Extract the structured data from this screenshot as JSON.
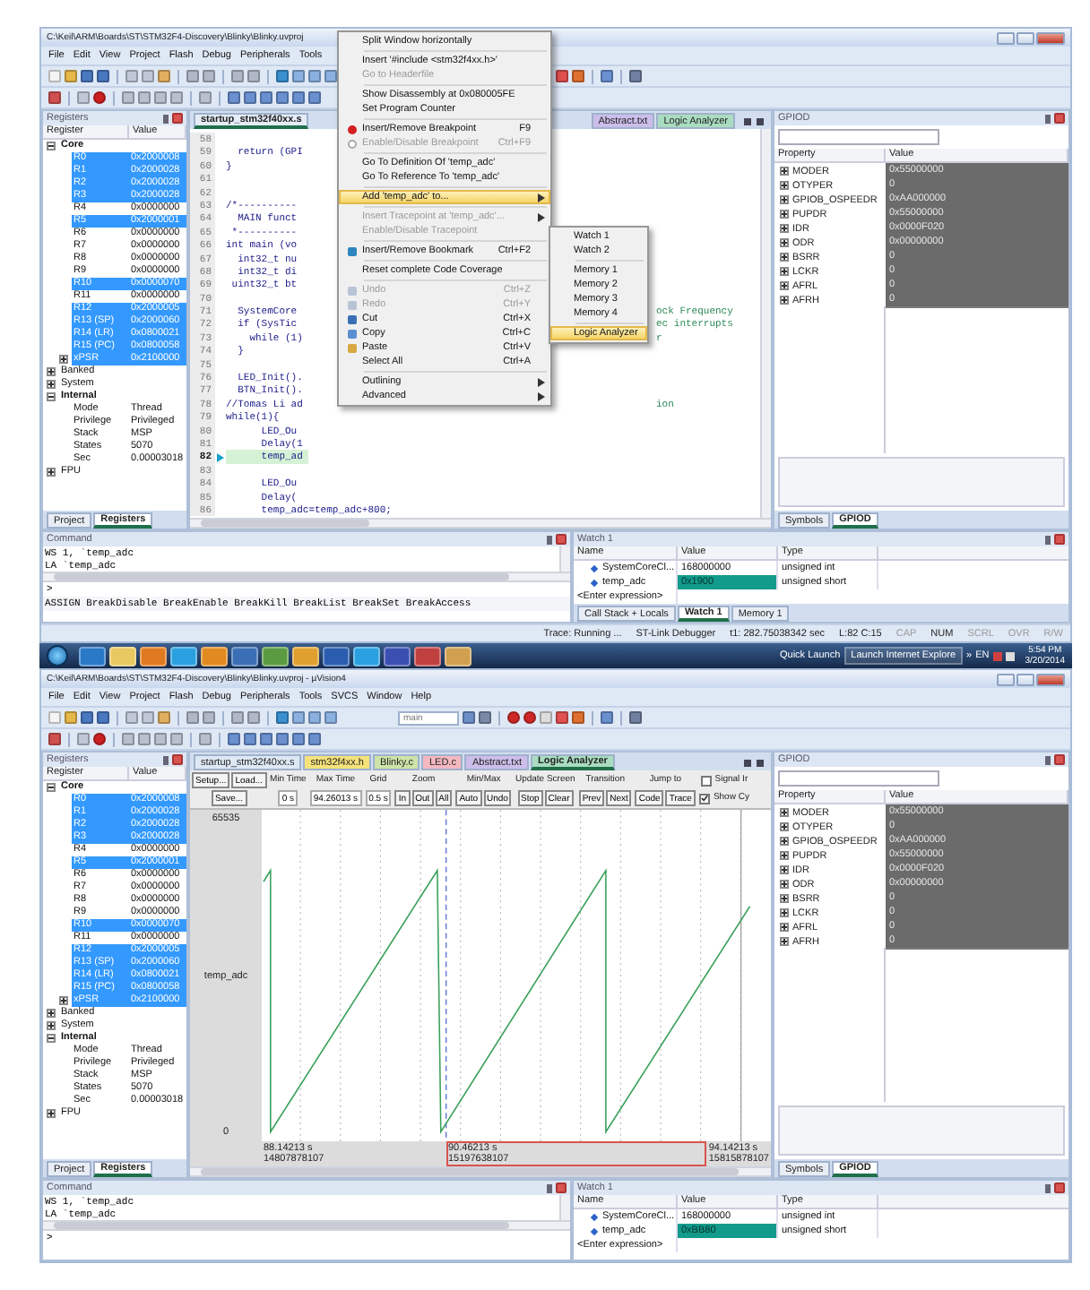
{
  "windows": [
    {
      "kind": "editor",
      "title": "C:\\Keil\\ARM\\Boards\\ST\\STM32F4-Discovery\\Blinky\\Blinky.uvproj",
      "menu": [
        "File",
        "Edit",
        "View",
        "Project",
        "Flash",
        "Debug",
        "Peripherals",
        "Tools"
      ],
      "registers": {
        "title": "Registers",
        "columns": [
          "Register",
          "Value"
        ],
        "tree": [
          {
            "name": "Core",
            "expanded": true,
            "children": [
              {
                "name": "R0",
                "value": "0x2000008",
                "selected": true
              },
              {
                "name": "R1",
                "value": "0x2000028",
                "selected": true
              },
              {
                "name": "R2",
                "value": "0x2000028",
                "selected": true
              },
              {
                "name": "R3",
                "value": "0x2000028",
                "selected": true
              },
              {
                "name": "R4",
                "value": "0x0000000",
                "selected": false
              },
              {
                "name": "R5",
                "value": "0x2000001",
                "selected": true
              },
              {
                "name": "R6",
                "value": "0x0000000",
                "selected": false
              },
              {
                "name": "R7",
                "value": "0x0000000",
                "selected": false
              },
              {
                "name": "R8",
                "value": "0x0000000",
                "selected": false
              },
              {
                "name": "R9",
                "value": "0x0000000",
                "selected": false
              },
              {
                "name": "R10",
                "value": "0x0000070",
                "selected": true
              },
              {
                "name": "R11",
                "value": "0x0000000",
                "selected": false
              },
              {
                "name": "R12",
                "value": "0x2000005",
                "selected": true
              },
              {
                "name": "R13 (SP)",
                "value": "0x2000060",
                "selected": true
              },
              {
                "name": "R14 (LR)",
                "value": "0x0800021",
                "selected": true
              },
              {
                "name": "R15 (PC)",
                "value": "0x0800058",
                "selected": true
              },
              {
                "name": "xPSR",
                "value": "0x2100000",
                "selected": true,
                "expanded": false
              }
            ]
          },
          {
            "name": "Banked",
            "expanded": false
          },
          {
            "name": "System",
            "expanded": false
          },
          {
            "name": "Internal",
            "expanded": true,
            "children": [
              {
                "name": "Mode",
                "value": "Thread",
                "selected": false
              },
              {
                "name": "Privilege",
                "value": "Privileged",
                "selected": false
              },
              {
                "name": "Stack",
                "value": "MSP",
                "selected": false
              },
              {
                "name": "States",
                "value": "5070",
                "selected": false
              },
              {
                "name": "Sec",
                "value": "0.00003018",
                "selected": false
              }
            ]
          },
          {
            "name": "FPU",
            "expanded": false
          }
        ],
        "tabs": [
          {
            "label": "Project",
            "selected": false
          },
          {
            "label": "Registers",
            "selected": true
          }
        ]
      },
      "editor": {
        "tabs": [
          {
            "label": "startup_stm32f40xx.s",
            "color": "#e4ecf7",
            "selected": true
          },
          {
            "label": "Abstract.txt",
            "color": "#cdbdea",
            "selected": false
          },
          {
            "label": "Logic Analyzer",
            "color": "#a9dcc0",
            "selected": false
          }
        ],
        "lines": [
          {
            "number": "58",
            "current": false
          },
          {
            "number": "59",
            "text": "  return (GPI",
            "current": false
          },
          {
            "number": "60",
            "text": "}",
            "current": false
          },
          {
            "number": "61",
            "current": false
          },
          {
            "number": "62",
            "current": false
          },
          {
            "number": "63",
            "text": "/*----------",
            "current": false
          },
          {
            "number": "64",
            "text": "  MAIN funct",
            "current": false
          },
          {
            "number": "65",
            "text": " *----------",
            "current": false
          },
          {
            "number": "66",
            "text": "int main (vo",
            "current": false
          },
          {
            "number": "67",
            "text": "  int32_t nu",
            "current": false
          },
          {
            "number": "68",
            "text": "  int32_t di",
            "current": false
          },
          {
            "number": "69",
            "text": " uint32_t bt",
            "current": false
          },
          {
            "number": "70",
            "current": false
          },
          {
            "number": "71",
            "text": "  SystemCore",
            "tail": "ock Frequency",
            "current": false
          },
          {
            "number": "72",
            "text": "  if (SysTic",
            "tail": "ec interrupts",
            "current": false
          },
          {
            "number": "73",
            "text": "    while (1)",
            "tail": "r",
            "current": false
          },
          {
            "number": "74",
            "text": "  }",
            "current": false
          },
          {
            "number": "75",
            "current": false
          },
          {
            "number": "76",
            "text": "  LED_Init().",
            "current": false
          },
          {
            "number": "77",
            "text": "  BTN_Init().",
            "current": false
          },
          {
            "number": "78",
            "text": "//Tomas Li ad",
            "tail": "ion",
            "current": false
          },
          {
            "number": "79",
            "text": "while(1){",
            "current": false
          },
          {
            "number": "80",
            "text": "      LED_Ou",
            "current": false
          },
          {
            "number": "81",
            "text": "      Delay(1",
            "current": false
          },
          {
            "number": "82",
            "text": "      temp_ad",
            "current": true
          },
          {
            "number": "83",
            "current": false
          },
          {
            "number": "84",
            "text": "      LED_Ou",
            "current": false
          },
          {
            "number": "85",
            "text": "      Delay(",
            "current": false
          },
          {
            "number": "86",
            "text": "      temp_adc=temp_adc+800;",
            "current": false
          }
        ],
        "context_menu": [
          {
            "kind": "item",
            "label": "Split Window horizontally",
            "disabled": false,
            "selected": false
          },
          {
            "kind": "separator"
          },
          {
            "kind": "item",
            "label": "Insert '#include <stm32f4xx.h>'",
            "disabled": false,
            "selected": false
          },
          {
            "kind": "item",
            "label": "Go to Headerfile",
            "disabled": true,
            "selected": false
          },
          {
            "kind": "separator"
          },
          {
            "kind": "item",
            "label": "Show Disassembly at 0x080005FE",
            "disabled": false,
            "selected": false
          },
          {
            "kind": "item",
            "label": "Set Program Counter",
            "disabled": false,
            "selected": false
          },
          {
            "kind": "separator"
          },
          {
            "kind": "item",
            "label": "Insert/Remove Breakpoint",
            "shortcut": "F9",
            "disabled": false,
            "selected": false
          },
          {
            "kind": "item",
            "label": "Enable/Disable Breakpoint",
            "shortcut": "Ctrl+F9",
            "disabled": true,
            "selected": false
          },
          {
            "kind": "separator"
          },
          {
            "kind": "item",
            "label": "Go To Definition Of 'temp_adc'",
            "disabled": false,
            "selected": false
          },
          {
            "kind": "item",
            "label": "Go To Reference To 'temp_adc'",
            "disabled": false,
            "selected": false
          },
          {
            "kind": "separator"
          },
          {
            "kind": "submenu",
            "label": "Add 'temp_adc' to...",
            "disabled": false,
            "selected": true
          },
          {
            "kind": "separator"
          },
          {
            "kind": "submenu",
            "label": "Insert Tracepoint at 'temp_adc'...",
            "disabled": true,
            "selected": false
          },
          {
            "kind": "item",
            "label": "Enable/Disable Tracepoint",
            "disabled": true,
            "selected": false
          },
          {
            "kind": "separator"
          },
          {
            "kind": "item",
            "label": "Insert/Remove Bookmark",
            "shortcut": "Ctrl+F2",
            "disabled": false,
            "selected": false
          },
          {
            "kind": "separator"
          },
          {
            "kind": "item",
            "label": "Reset complete Code Coverage",
            "disabled": false,
            "selected": false
          },
          {
            "kind": "separator"
          },
          {
            "kind": "item",
            "label": "Undo",
            "shortcut": "Ctrl+Z",
            "disabled": true,
            "selected": false
          },
          {
            "kind": "item",
            "label": "Redo",
            "shortcut": "Ctrl+Y",
            "disabled": true,
            "selected": false
          },
          {
            "kind": "item",
            "label": "Cut",
            "shortcut": "Ctrl+X",
            "disabled": false,
            "selected": false
          },
          {
            "kind": "item",
            "label": "Copy",
            "shortcut": "Ctrl+C",
            "disabled": false,
            "selected": false
          },
          {
            "kind": "item",
            "label": "Paste",
            "shortcut": "Ctrl+V",
            "disabled": false,
            "selected": false
          },
          {
            "kind": "item",
            "label": "Select All",
            "shortcut": "Ctrl+A",
            "disabled": false,
            "selected": false
          },
          {
            "kind": "separator"
          },
          {
            "kind": "submenu",
            "label": "Outlining",
            "disabled": false,
            "selected": false
          },
          {
            "kind": "submenu",
            "label": "Advanced",
            "disabled": false,
            "selected": false
          }
        ],
        "submenu": [
          {
            "kind": "item",
            "label": "Watch 1",
            "disabled": false,
            "selected": false
          },
          {
            "kind": "item",
            "label": "Watch 2",
            "disabled": false,
            "selected": false
          },
          {
            "kind": "separator"
          },
          {
            "kind": "item",
            "label": "Memory 1",
            "disabled": false,
            "selected": false
          },
          {
            "kind": "item",
            "label": "Memory 2",
            "disabled": false,
            "selected": false
          },
          {
            "kind": "item",
            "label": "Memory 3",
            "disabled": false,
            "selected": false
          },
          {
            "kind": "item",
            "label": "Memory 4",
            "disabled": false,
            "selected": false
          },
          {
            "kind": "separator"
          },
          {
            "kind": "item",
            "label": "Logic Analyzer",
            "disabled": false,
            "selected": true
          }
        ]
      },
      "gpio": {
        "title": "GPIOD",
        "columns": [
          "Property",
          "Value"
        ],
        "rows": [
          {
            "name": "MODER",
            "value": "0x55000000"
          },
          {
            "name": "OTYPER",
            "value": "0"
          },
          {
            "name": "GPIOB_OSPEEDR",
            "value": "0xAA000000"
          },
          {
            "name": "PUPDR",
            "value": "0x55000000"
          },
          {
            "name": "IDR",
            "value": "0x0000F020"
          },
          {
            "name": "ODR",
            "value": "0x00000000"
          },
          {
            "name": "BSRR",
            "value": "0"
          },
          {
            "name": "LCKR",
            "value": "0"
          },
          {
            "name": "AFRL",
            "value": "0"
          },
          {
            "name": "AFRH",
            "value": "0"
          }
        ],
        "tabs": [
          {
            "label": "Symbols",
            "selected": false
          },
          {
            "label": "GPIOD",
            "selected": true
          }
        ]
      },
      "command": {
        "title": "Command",
        "lines": [
          "WS 1, `temp_adc",
          "LA `temp_adc"
        ],
        "prompt": ">",
        "help": "ASSIGN BreakDisable BreakEnable BreakKill BreakList BreakSet BreakAccess"
      },
      "watch": {
        "title": "Watch 1",
        "columns": [
          "Name",
          "Value",
          "Type"
        ],
        "rows": [
          {
            "name": "SystemCoreCl...",
            "value": "168000000",
            "type": "unsigned int",
            "changed": false
          },
          {
            "name": "temp_adc",
            "value": "0x1900",
            "type": "unsigned short",
            "changed": true
          }
        ],
        "placeholder": "<Enter expression>",
        "tabs": [
          {
            "label": "Call Stack + Locals",
            "selected": false
          },
          {
            "label": "Watch 1",
            "selected": true
          },
          {
            "label": "Memory 1",
            "selected": false
          }
        ]
      },
      "status_bar": [
        {
          "text": "Trace: Running ...",
          "on": true
        },
        {
          "text": "ST-Link Debugger",
          "on": true
        },
        {
          "text": "t1: 282.75038342 sec",
          "on": true
        },
        {
          "text": "L:82 C:15",
          "on": true
        },
        {
          "text": "CAP",
          "on": false
        },
        {
          "text": "NUM",
          "on": true
        },
        {
          "text": "SCRL",
          "on": false
        },
        {
          "text": "OVR",
          "on": false
        },
        {
          "text": "R/W",
          "on": false
        }
      ]
    },
    {
      "kind": "analyzer",
      "title": "C:\\Keil\\ARM\\Boards\\ST\\STM32F4-Discovery\\Blinky\\Blinky.uvproj - µVision4",
      "menu": [
        "File",
        "Edit",
        "View",
        "Project",
        "Flash",
        "Debug",
        "Peripherals",
        "Tools",
        "SVCS",
        "Window",
        "Help"
      ],
      "combo": "main",
      "registers": {
        "title": "Registers",
        "columns": [
          "Register",
          "Value"
        ],
        "tree": [
          {
            "name": "Core",
            "expanded": true,
            "children": [
              {
                "name": "R0",
                "value": "0x2000008",
                "selected": true
              },
              {
                "name": "R1",
                "value": "0x2000028",
                "selected": true
              },
              {
                "name": "R2",
                "value": "0x2000028",
                "selected": true
              },
              {
                "name": "R3",
                "value": "0x2000028",
                "selected": true
              },
              {
                "name": "R4",
                "value": "0x0000000",
                "selected": false
              },
              {
                "name": "R5",
                "value": "0x2000001",
                "selected": true
              },
              {
                "name": "R6",
                "value": "0x0000000",
                "selected": false
              },
              {
                "name": "R7",
                "value": "0x0000000",
                "selected": false
              },
              {
                "name": "R8",
                "value": "0x0000000",
                "selected": false
              },
              {
                "name": "R9",
                "value": "0x0000000",
                "selected": false
              },
              {
                "name": "R10",
                "value": "0x0000070",
                "selected": true
              },
              {
                "name": "R11",
                "value": "0x0000000",
                "selected": false
              },
              {
                "name": "R12",
                "value": "0x2000005",
                "selected": true
              },
              {
                "name": "R13 (SP)",
                "value": "0x2000060",
                "selected": true
              },
              {
                "name": "R14 (LR)",
                "value": "0x0800021",
                "selected": true
              },
              {
                "name": "R15 (PC)",
                "value": "0x0800058",
                "selected": true
              },
              {
                "name": "xPSR",
                "value": "0x2100000",
                "selected": true,
                "expanded": false
              }
            ]
          },
          {
            "name": "Banked",
            "expanded": false
          },
          {
            "name": "System",
            "expanded": false
          },
          {
            "name": "Internal",
            "expanded": true,
            "children": [
              {
                "name": "Mode",
                "value": "Thread",
                "selected": false
              },
              {
                "name": "Privilege",
                "value": "Privileged",
                "selected": false
              },
              {
                "name": "Stack",
                "value": "MSP",
                "selected": false
              },
              {
                "name": "States",
                "value": "5070",
                "selected": false
              },
              {
                "name": "Sec",
                "value": "0.00003018",
                "selected": false
              }
            ]
          },
          {
            "name": "FPU",
            "expanded": false
          }
        ],
        "tabs": [
          {
            "label": "Project",
            "selected": false
          },
          {
            "label": "Registers",
            "selected": true
          }
        ]
      },
      "editor": {
        "tabs": [
          {
            "label": "startup_stm32f40xx.s",
            "color": "#dde8f5",
            "selected": false
          },
          {
            "label": "stm32f4xx.h",
            "color": "#f5e27a",
            "selected": false
          },
          {
            "label": "Blinky.c",
            "color": "#cde3a8",
            "selected": false
          },
          {
            "label": "LED.c",
            "color": "#f4b8c0",
            "selected": false
          },
          {
            "label": "Abstract.txt",
            "color": "#cdbdea",
            "selected": false
          },
          {
            "label": "Logic Analyzer",
            "color": "#a9dcc0",
            "selected": true
          }
        ]
      },
      "analyzer": {
        "buttons": [
          "Setup...",
          "Load...",
          "Save..."
        ],
        "groups": [
          {
            "label": "Min Time",
            "values": [
              "0 s"
            ]
          },
          {
            "label": "Max Time",
            "values": [
              "94.26013 s"
            ]
          },
          {
            "label": "Grid",
            "values": [
              "0.5 s"
            ]
          },
          {
            "label": "Zoom",
            "buttons": [
              "In",
              "Out",
              "All"
            ]
          },
          {
            "label": "Min/Max",
            "buttons": [
              "Auto",
              "Undo"
            ]
          },
          {
            "label": "Update Screen",
            "buttons": [
              "Stop",
              "Clear"
            ]
          },
          {
            "label": "Transition",
            "buttons": [
              "Prev",
              "Next"
            ]
          },
          {
            "label": "Jump to",
            "buttons": [
              "Code",
              "Trace"
            ]
          }
        ],
        "options": [
          {
            "label": "Signal Ir",
            "checked": false
          },
          {
            "label": "Show Cy",
            "checked": true
          }
        ],
        "y_max": "65535",
        "y_min": "0",
        "signal": "temp_adc",
        "cursors": [
          {
            "kind": "edge",
            "time": "88.14213 s",
            "ticks": "14807878107"
          },
          {
            "kind": "cursor",
            "time": "90.46213 s",
            "ticks": "15197638107"
          },
          {
            "kind": "edge",
            "time": "94.14213 s",
            "ticks": "15815878107"
          }
        ]
      },
      "gpio": {
        "title": "GPIOD",
        "columns": [
          "Property",
          "Value"
        ],
        "rows": [
          {
            "name": "MODER",
            "value": "0x55000000"
          },
          {
            "name": "OTYPER",
            "value": "0"
          },
          {
            "name": "GPIOB_OSPEEDR",
            "value": "0xAA000000"
          },
          {
            "name": "PUPDR",
            "value": "0x55000000"
          },
          {
            "name": "IDR",
            "value": "0x0000F020"
          },
          {
            "name": "ODR",
            "value": "0x00000000"
          },
          {
            "name": "BSRR",
            "value": "0"
          },
          {
            "name": "LCKR",
            "value": "0"
          },
          {
            "name": "AFRL",
            "value": "0"
          },
          {
            "name": "AFRH",
            "value": "0"
          }
        ],
        "tabs": [
          {
            "label": "Symbols",
            "selected": false
          },
          {
            "label": "GPIOD",
            "selected": true
          }
        ]
      },
      "command": {
        "title": "Command",
        "lines": [
          "WS 1, `temp_adc",
          "LA `temp_adc"
        ],
        "prompt": ">"
      },
      "watch": {
        "title": "Watch 1",
        "columns": [
          "Name",
          "Value",
          "Type"
        ],
        "rows": [
          {
            "name": "SystemCoreCl...",
            "value": "168000000",
            "type": "unsigned int",
            "changed": false
          },
          {
            "name": "temp_adc",
            "value": "0xBB80",
            "type": "unsigned short",
            "changed": true
          }
        ],
        "placeholder": "<Enter expression>"
      }
    }
  ],
  "taskbar": {
    "quick_launch": "Quick Launch",
    "launch_button": "Launch Internet Explore",
    "overflow": "»",
    "language": "EN",
    "time": "5:54 PM",
    "date": "3/20/2014"
  }
}
